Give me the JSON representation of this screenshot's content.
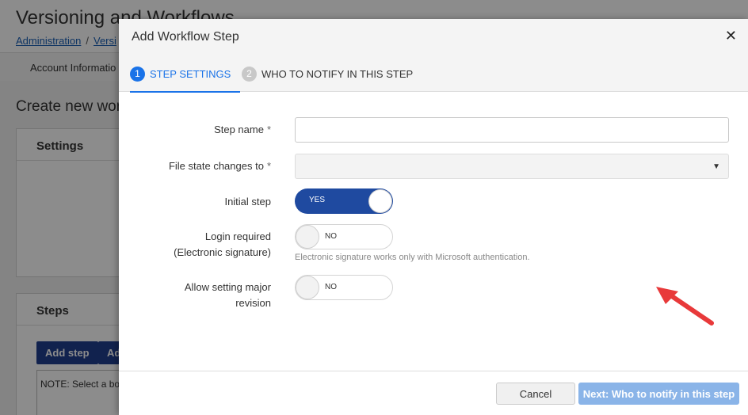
{
  "background": {
    "page_title": "Versioning and Workflows",
    "breadcrumb": {
      "item1": "Administration",
      "separator": "/",
      "item2": "Versi"
    },
    "tab": "Account Informatio",
    "subtitle": "Create new wor",
    "settings_panel_title": "Settings",
    "steps_panel_title": "Steps",
    "add_step_label": "Add step",
    "add_other_label": "Ad",
    "note_text": "NOTE: Select a bo"
  },
  "modal": {
    "title": "Add Workflow Step",
    "close_icon": "close-icon",
    "tabs": [
      {
        "number": "1",
        "label": "STEP SETTINGS",
        "active": true
      },
      {
        "number": "2",
        "label": "WHO TO NOTIFY IN THIS STEP",
        "active": false
      }
    ],
    "form": {
      "step_name": {
        "label": "Step name",
        "required_mark": "*",
        "value": ""
      },
      "file_state": {
        "label": "File state changes to",
        "required_mark": "*",
        "value": "",
        "caret": "▼"
      },
      "initial_step": {
        "label": "Initial step",
        "toggle_text": "YES",
        "on": true
      },
      "login_required": {
        "label_line1": "Login required",
        "label_line2": "(Electronic signature)",
        "toggle_text": "NO",
        "on": false,
        "help": "Electronic signature works only with Microsoft authentication."
      },
      "major_revision": {
        "label_line1": "Allow setting major",
        "label_line2": "revision",
        "toggle_text": "NO",
        "on": false
      }
    },
    "footer": {
      "cancel_label": "Cancel",
      "next_label": "Next: Who to notify in this step"
    }
  },
  "colors": {
    "accent": "#1a73e8",
    "toggle_on": "#1f4aa0",
    "next_button": "#8ab4e8",
    "annotation_arrow": "#e8393a"
  }
}
